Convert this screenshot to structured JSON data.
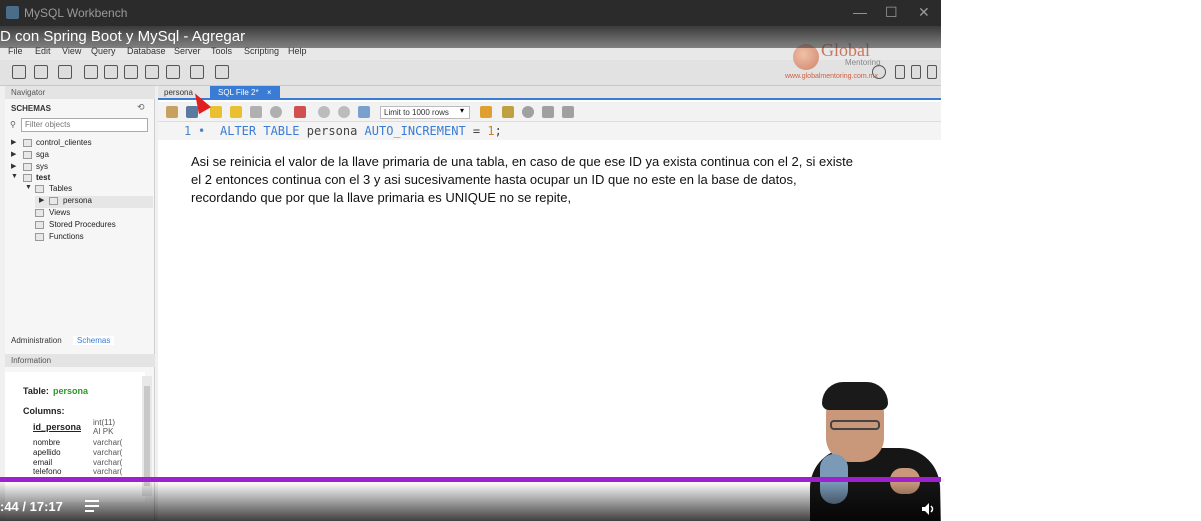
{
  "window": {
    "title": "MySQL Workbench"
  },
  "video": {
    "title": "D con Spring Boot y MySql - Agregar",
    "time": ":44 / 17:17"
  },
  "menu": [
    "File",
    "Edit",
    "View",
    "Query",
    "Database",
    "Server",
    "Tools",
    "Scripting",
    "Help"
  ],
  "brand": {
    "name": "Global",
    "sub": "Mentoring",
    "url": "www.globalmentoring.com.mx"
  },
  "sidebar": {
    "navigator": "Navigator",
    "schemas_header": "SCHEMAS",
    "filter_placeholder": "Filter objects",
    "tree": [
      "control_clientes",
      "sga",
      "sys",
      "test",
      "Tables",
      "persona",
      "Views",
      "Stored Procedures",
      "Functions"
    ],
    "tabs": [
      "Administration",
      "Schemas"
    ],
    "information": "Information",
    "info": {
      "table_label": "Table:",
      "table_name": "persona",
      "columns_label": "Columns:",
      "columns": [
        {
          "name": "id_persona",
          "type": "int(11)",
          "extra": "AI PK"
        },
        {
          "name": "nombre",
          "type": "varchar("
        },
        {
          "name": "apellido",
          "type": "varchar("
        },
        {
          "name": "email",
          "type": "varchar("
        },
        {
          "name": "telefono",
          "type": "varchar("
        }
      ]
    }
  },
  "editor": {
    "tabs": [
      "persona",
      "SQL File 2*"
    ],
    "tab_close": "×",
    "limit": "Limit to 1000 rows",
    "line_number": "1",
    "code": {
      "kw1": "ALTER TABLE",
      "id1": "persona",
      "kw2": "AUTO_INCREMENT",
      "op": "=",
      "num": "1",
      "end": ";"
    },
    "note": [
      "Asi se reinicia el valor de la llave primaria de una tabla, en caso de que ese ID ya exista continua con el 2, si existe",
      "el 2 entonces continua con el 3 y asi sucesivamente hasta ocupar un ID que no este en la base de datos,",
      "recordando que por que la llave primaria es UNIQUE no se repite,"
    ]
  },
  "colors": {
    "progress": "#a020d0",
    "tab_active": "#3a7bd5",
    "keyword": "#3a7bd5",
    "number": "#d08020"
  }
}
